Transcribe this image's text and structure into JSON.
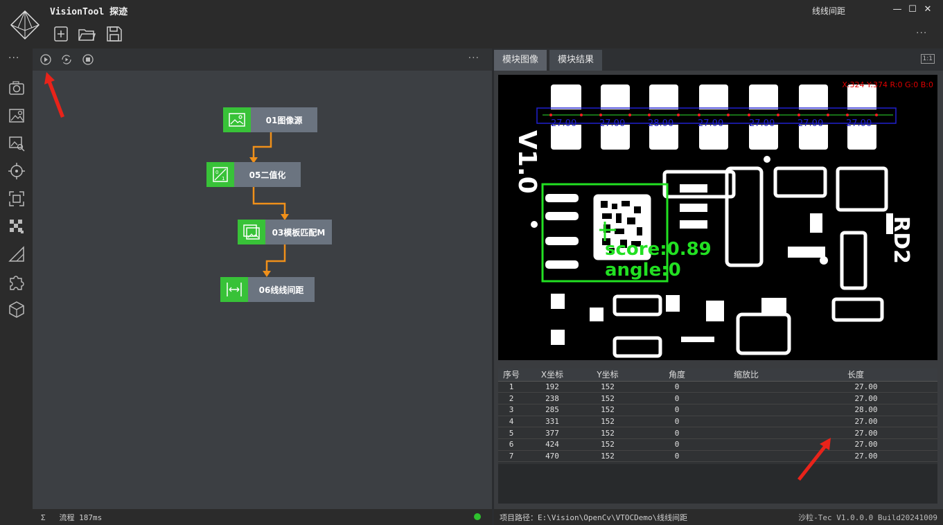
{
  "app": {
    "title": "VisionTool 探迹",
    "window_title": "线线间距"
  },
  "toolbar": {
    "icons": [
      "new-file-icon",
      "open-folder-icon",
      "save-icon"
    ]
  },
  "leftbar": {
    "icons": [
      "camera-icon",
      "image-settings-icon",
      "image-search-icon",
      "target-icon",
      "focus-icon",
      "checker-icon",
      "ruler-icon",
      "puzzle-icon",
      "cube-icon"
    ]
  },
  "flow": {
    "nodes": [
      {
        "label": "01图像源",
        "icon": "image-icon"
      },
      {
        "label": "05二值化",
        "icon": "binarize-icon"
      },
      {
        "label": "03模板匹配M",
        "icon": "template-icon"
      },
      {
        "label": "06线线间距",
        "icon": "distance-icon"
      }
    ],
    "status": "流程 187ms",
    "status_color": "#2ec12e"
  },
  "right": {
    "tabs": [
      "模块图像",
      "模块结果"
    ],
    "zoom_label": "1:1",
    "pixel_info": "X:324 Y:374 R:0 G:0 B:0",
    "overlay": {
      "measurements": [
        "27.00",
        "27.00",
        "28.00",
        "27.00",
        "27.00",
        "27.00",
        "27.00"
      ],
      "score_text": "score:0.89",
      "angle_text": "angle:0"
    },
    "table": {
      "headers": [
        "序号",
        "X坐标",
        "Y坐标",
        "角度",
        "缩放比",
        "长度"
      ],
      "rows": [
        [
          "1",
          "192",
          "152",
          "0",
          "",
          "27.00"
        ],
        [
          "2",
          "238",
          "152",
          "0",
          "",
          "27.00"
        ],
        [
          "3",
          "285",
          "152",
          "0",
          "",
          "28.00"
        ],
        [
          "4",
          "331",
          "152",
          "0",
          "",
          "27.00"
        ],
        [
          "5",
          "377",
          "152",
          "0",
          "",
          "27.00"
        ],
        [
          "6",
          "424",
          "152",
          "0",
          "",
          "27.00"
        ],
        [
          "7",
          "470",
          "152",
          "0",
          "",
          "27.00"
        ]
      ]
    },
    "project_path": "项目路径：E:\\Vision\\OpenCv\\VTOCDemo\\线线间距",
    "version": "沙粒-Tec V1.0.0.0 Build20241009"
  }
}
